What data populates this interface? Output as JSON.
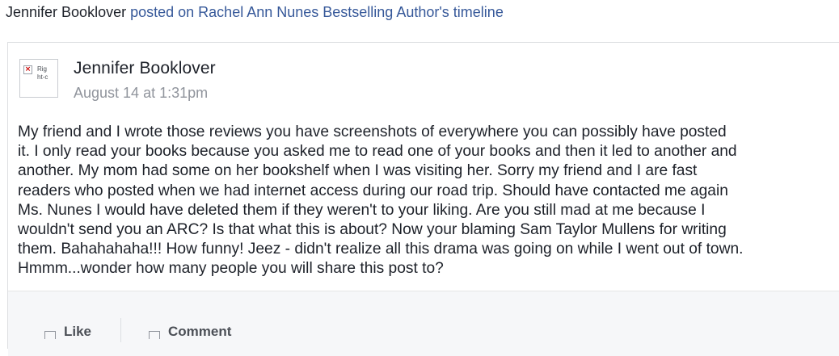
{
  "header": {
    "author": "Jennifer Booklover",
    "action_text": "posted on Rachel Ann Nunes Bestselling Author's timeline"
  },
  "post": {
    "avatar": {
      "broken_glyph": "×",
      "alt_text": "Right-c"
    },
    "poster_name": "Jennifer Booklover",
    "timestamp": "August 14 at 1:31pm",
    "body": "My friend and I wrote those reviews you have screenshots of everywhere you can possibly have posted\nit. I only read your books because you asked me to read one of your books and then it led to another and\nanother. My mom had some on her bookshelf when I was visiting her. Sorry my friend and I are fast\nreaders who posted when we had internet access during our road trip. Should have contacted me again\nMs. Nunes I would have deleted them if they weren't to your liking. Are you still mad at me because I\nwouldn't send you an ARC? Is that what this is about? Now your blaming Sam Taylor Mullens for writing\nthem. Bahahahaha!!! How funny! Jeez - didn't realize all this drama was going on while I went out of town.\nHmmm...wonder how many people you will share this post to?"
  },
  "actions": {
    "like_label": "Like",
    "comment_label": "Comment"
  }
}
